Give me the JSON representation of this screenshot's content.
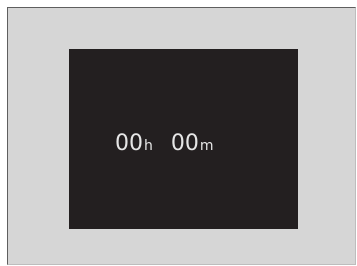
{
  "timer_display": {
    "hours_value": "00",
    "hours_unit": "h",
    "minutes_value": "00",
    "minutes_unit": "m"
  },
  "colors": {
    "frame_background": "#d6d6d6",
    "screen_background": "#231f20",
    "digit_color": "#e6e6e6"
  }
}
